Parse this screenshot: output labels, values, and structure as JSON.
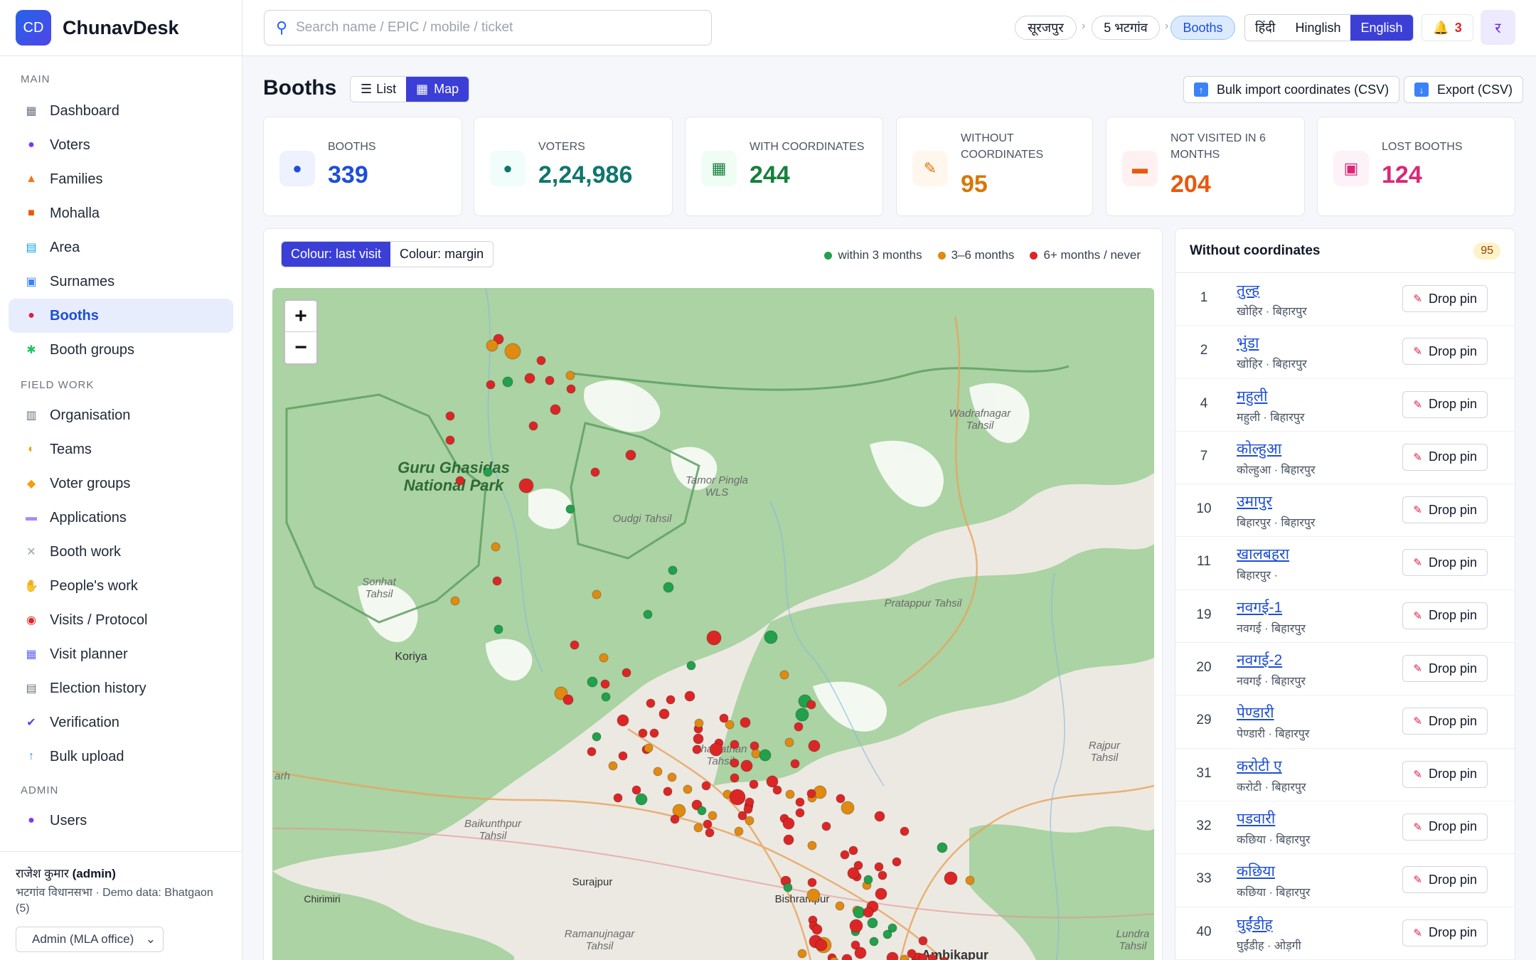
{
  "brand": {
    "logo": "CD",
    "name": "ChunavDesk"
  },
  "nav": {
    "sections": [
      "MAIN",
      "FIELD WORK",
      "ADMIN"
    ],
    "main": [
      {
        "label": "Dashboard",
        "icon": "dashboard-icon"
      },
      {
        "label": "Voters",
        "icon": "voter-icon"
      },
      {
        "label": "Families",
        "icon": "family-icon"
      },
      {
        "label": "Mohalla",
        "icon": "mohalla-icon"
      },
      {
        "label": "Area",
        "icon": "area-map-icon"
      },
      {
        "label": "Surnames",
        "icon": "surname-icon"
      },
      {
        "label": "Booths",
        "icon": "booth-pin-icon",
        "active": true
      },
      {
        "label": "Booth groups",
        "icon": "booth-groups-icon"
      }
    ],
    "field": [
      {
        "label": "Organisation",
        "icon": "organisation-icon"
      },
      {
        "label": "Teams",
        "icon": "teams-icon"
      },
      {
        "label": "Voter groups",
        "icon": "voter-groups-icon"
      },
      {
        "label": "Applications",
        "icon": "applications-icon"
      },
      {
        "label": "Booth work",
        "icon": "booth-work-icon"
      },
      {
        "label": "People's work",
        "icon": "peoples-work-icon"
      },
      {
        "label": "Visits / Protocol",
        "icon": "visits-icon"
      },
      {
        "label": "Visit planner",
        "icon": "calendar-icon"
      },
      {
        "label": "Election history",
        "icon": "election-history-icon"
      },
      {
        "label": "Verification",
        "icon": "check-icon"
      },
      {
        "label": "Bulk upload",
        "icon": "upload-icon"
      }
    ],
    "admin": [
      {
        "label": "Users",
        "icon": "users-icon"
      }
    ]
  },
  "footer": {
    "user_name": "राजेश कुमार",
    "user_role": "(admin)",
    "sub": "भटगांव विधानसभा · Demo data: Bhatgaon (5)",
    "role_select": "Admin (MLA office)"
  },
  "topbar": {
    "search_placeholder": "Search name / EPIC / mobile / ticket",
    "crumbs": [
      "सूरजपुर",
      "5 भटगांव",
      "Booths"
    ],
    "languages": [
      "हिंदी",
      "Hinglish",
      "English"
    ],
    "active_language": "English",
    "notifications": "3",
    "avatar": "र"
  },
  "page": {
    "title": "Booths",
    "views": [
      "List",
      "Map"
    ],
    "active_view": "Map",
    "bulk_import": "Bulk import coordinates (CSV)",
    "export": "Export (CSV)"
  },
  "stats": [
    {
      "label": "BOOTHS",
      "value": "339",
      "color": "#1d4ed8",
      "icon": "pin-icon"
    },
    {
      "label": "VOTERS",
      "value": "2,24,986",
      "color": "#0f766e",
      "icon": "voter-icon"
    },
    {
      "label": "WITH COORDINATES",
      "value": "244",
      "color": "#15803d",
      "icon": "map-icon"
    },
    {
      "label": "WITHOUT COORDINATES",
      "value": "95",
      "color": "#d97706",
      "icon": "pushpin-icon"
    },
    {
      "label": "NOT VISITED IN 6 MONTHS",
      "value": "204",
      "color": "#ea580c",
      "icon": "car-icon"
    },
    {
      "label": "LOST BOOTHS",
      "value": "124",
      "color": "#db2777",
      "icon": "lost-icon"
    }
  ],
  "map": {
    "colour_modes": [
      "Colour: last visit",
      "Colour: margin"
    ],
    "active_mode": "Colour: last visit",
    "legend": [
      {
        "label": "within 3 months",
        "color": "#22a04b"
      },
      {
        "label": "3–6 months",
        "color": "#e08a12"
      },
      {
        "label": "6+ months / never",
        "color": "#dc2626"
      }
    ],
    "labels": [
      "Guru Ghasidas National Park",
      "Tamor Pingla WLS",
      "Oudgi Tahsil",
      "Sonhat Tahsil",
      "Koriya",
      "Wadrafnagar Tahsil",
      "Pratappur Tahsil",
      "Bhaiyathan Tahsil",
      "Baikunthpur Tahsil",
      "Surajpur",
      "Bishrampur",
      "Chirimiri",
      "Ramanujnagar Tahsil",
      "Rajpur Tahsil",
      "Ambikapur",
      "Lundra Tahsil",
      "arh"
    ],
    "zoom_in": "+",
    "zoom_out": "−"
  },
  "without_coords": {
    "title": "Without coordinates",
    "count": "95",
    "button_label": "Drop pin",
    "rows": [
      {
        "num": "1",
        "name": "तुल्ह",
        "sub": "खोहिर · बिहारपुर"
      },
      {
        "num": "2",
        "name": "भुंडा",
        "sub": "खोहिर · बिहारपुर"
      },
      {
        "num": "4",
        "name": "महुली",
        "sub": "महुली · बिहारपुर"
      },
      {
        "num": "7",
        "name": "कोल्हुआ",
        "sub": "कोल्हुआ · बिहारपुर"
      },
      {
        "num": "10",
        "name": "उमापुर",
        "sub": "बिहारपुर · बिहारपुर"
      },
      {
        "num": "11",
        "name": "खालबहरा",
        "sub": "बिहारपुर ·"
      },
      {
        "num": "19",
        "name": "नवगई-1",
        "sub": "नवगई · बिहारपुर"
      },
      {
        "num": "20",
        "name": "नवगई-2",
        "sub": "नवगई · बिहारपुर"
      },
      {
        "num": "29",
        "name": "पेण्डारी",
        "sub": "पेण्डारी · बिहारपुर"
      },
      {
        "num": "31",
        "name": "करोटी ए",
        "sub": "करोटी · बिहारपुर"
      },
      {
        "num": "32",
        "name": "पडवारी",
        "sub": "कछिया · बिहारपुर"
      },
      {
        "num": "33",
        "name": "कछिया",
        "sub": "कछिया · बिहारपुर"
      },
      {
        "num": "40",
        "name": "घुईंडीह",
        "sub": "घुईंडीह · ओड़गी"
      }
    ]
  }
}
